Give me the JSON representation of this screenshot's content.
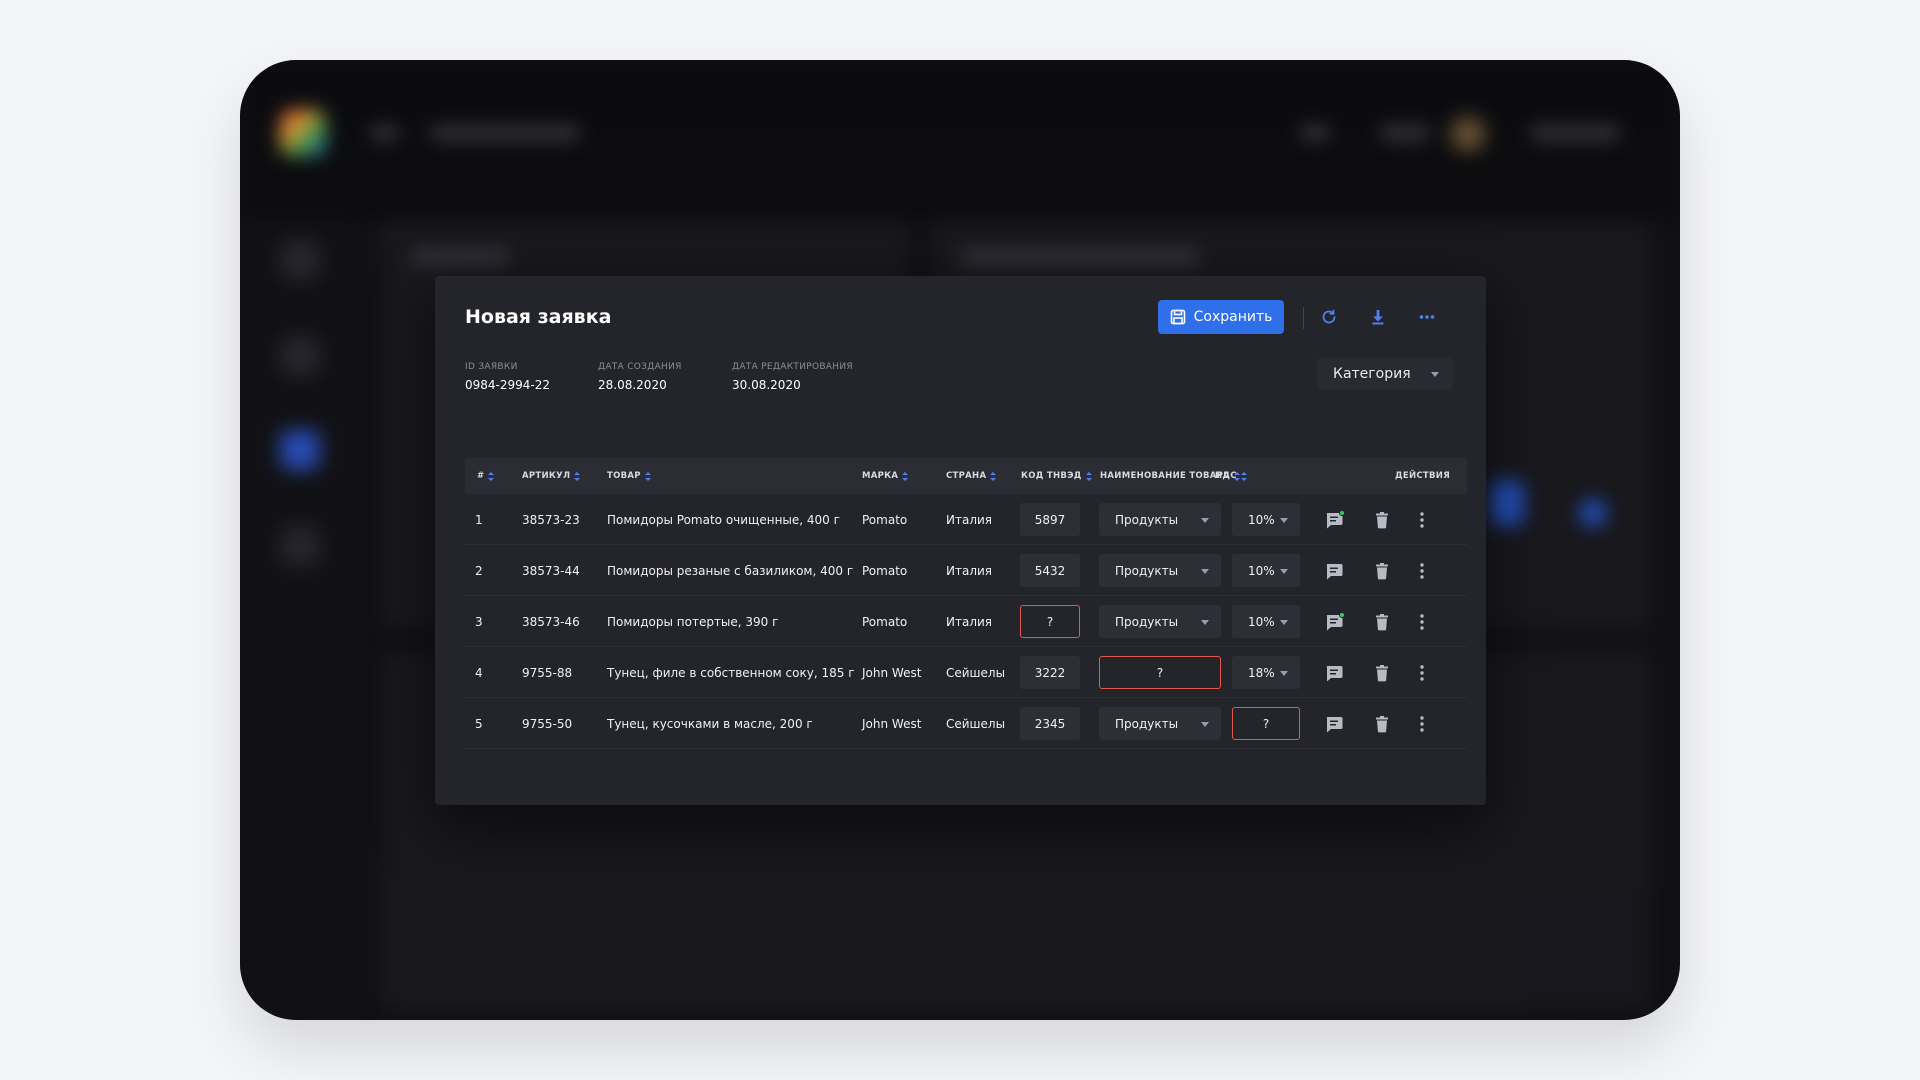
{
  "modal": {
    "title": "Новая заявка",
    "save_label": "Сохранить",
    "category_label": "Категория"
  },
  "meta": [
    {
      "label": "ID ЗАЯВКИ",
      "value": "0984-2994-22"
    },
    {
      "label": "ДАТА СОЗДАНИЯ",
      "value": "28.08.2020"
    },
    {
      "label": "ДАТА РЕДАКТИРОВАНИЯ",
      "value": "30.08.2020"
    }
  ],
  "table": {
    "headers": [
      "#",
      "АРТИКУЛ",
      "ТОВАР",
      "МАРКА",
      "СТРАНА",
      "КОД ТНВЭД",
      "НАИМЕНОВАНИЕ ТОВАРА",
      "НДС",
      "ДЕЙСТВИЯ"
    ],
    "rows": [
      {
        "num": "1",
        "sku": "38573-23",
        "product": "Помидоры Pomato очищенные, 400 г",
        "brand": "Pomato",
        "country": "Италия",
        "tnved": "5897",
        "name": "Продукты",
        "vat": "10%"
      },
      {
        "num": "2",
        "sku": "38573-44",
        "product": "Помидоры резаные с базиликом, 400 г",
        "brand": "Pomato",
        "country": "Италия",
        "tnved": "5432",
        "name": "Продукты",
        "vat": "10%"
      },
      {
        "num": "3",
        "sku": "38573-46",
        "product": "Помидоры потертые, 390 г",
        "brand": "Pomato",
        "country": "Италия",
        "tnved": "?",
        "name": "Продукты",
        "vat": "10%"
      },
      {
        "num": "4",
        "sku": "9755-88",
        "product": "Тунец, филе в собственном соку, 185 г",
        "brand": "John West",
        "country": "Сейшелы",
        "tnved": "3222",
        "name": "?",
        "vat": "18%"
      },
      {
        "num": "5",
        "sku": "9755-50",
        "product": "Тунец, кусочками в масле, 200 г",
        "brand": "John West",
        "country": "Сейшелы",
        "tnved": "2345",
        "name": "Продукты",
        "vat": "?"
      }
    ]
  },
  "colors": {
    "accent": "#2f6fea",
    "error": "#e8554d",
    "comment_dot": "#3cc36c"
  }
}
